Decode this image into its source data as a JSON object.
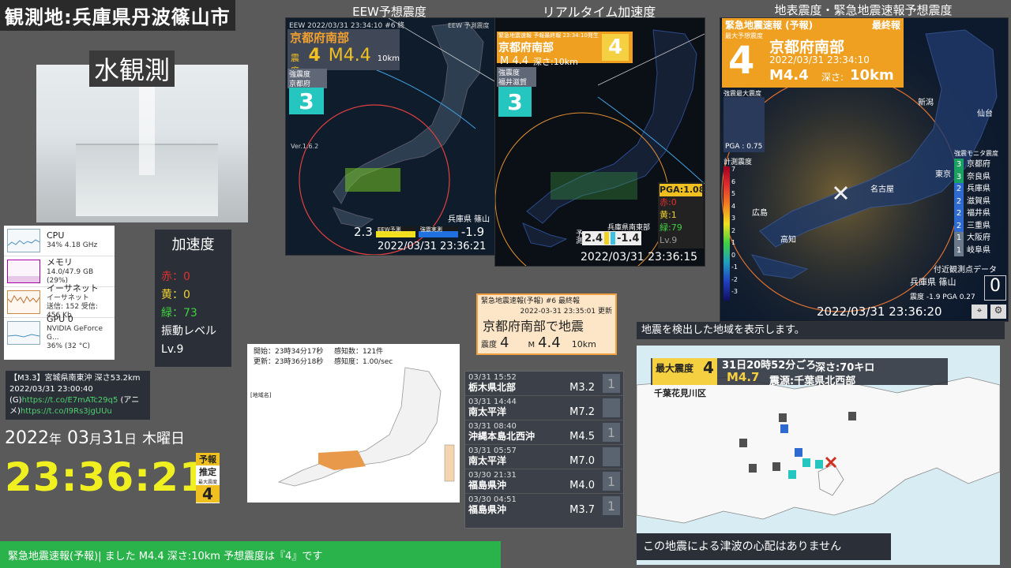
{
  "location_title": "観測地:兵庫県丹波篠山市",
  "water": {
    "label": "水観測"
  },
  "monitor": {
    "items": [
      {
        "name": "CPU",
        "detail": "34% 4.18 GHz"
      },
      {
        "name": "メモリ",
        "detail": "14.0/47.9 GB (29%)"
      },
      {
        "name": "イーサネット",
        "detail": "イーサネット\n送信: 152 受信: 456 Kb"
      },
      {
        "name": "GPU 0",
        "detail": "NVIDIA GeForce G...\n36% (32 °C)"
      }
    ]
  },
  "accel": {
    "title": "加速度",
    "red": "赤：0",
    "yellow": "黄：0",
    "green": "緑：73",
    "vib_label": "振動レベル",
    "vib_level": "Lv.9"
  },
  "tweet": {
    "line1": "【M3.3】宮城県南東沖 深さ53.2km",
    "line2": "2022/03/31 23:00:40",
    "line3a": "(G)",
    "line3b": "https://t.co/E7mATc29q5",
    "line3c": " (アニ",
    "line4a": "メ)",
    "line4b": "https://t.co/I9Rs3jgUUu"
  },
  "clock": {
    "date_y": "2022",
    "date_y_unit": "年",
    "date_m": "03",
    "date_m_unit": "月",
    "date_d": "31",
    "date_d_unit": "日",
    "weekday": "木曜日",
    "time": "23:36:21",
    "badge_top": "予報",
    "badge_mid": "推定",
    "badge_sub": "最大震度",
    "badge_int": "4"
  },
  "eew_panel": {
    "caption": "EEW予想震度",
    "header": "EEW  2022/03/31  23:34:10  #6  終",
    "region": "京都府南部",
    "int_label": "震度",
    "int": "4",
    "mag": "M4.4",
    "depth": "10km",
    "strong_label": "強震度",
    "strong_pref": "京都府",
    "strong_int": "3",
    "version": "Ver.1.6.2",
    "station": "兵庫県 篠山",
    "left_val": "2.3",
    "legend1": "EEW予測",
    "legend2": "強震実測",
    "right_val": "-1.9",
    "timestamp": "2022/03/31  23:36:21",
    "corner_label": "EEW 予測震度"
  },
  "realtime_panel": {
    "caption": "リアルタイム加速度",
    "header": "緊急地震速報 予報最終報 23:34:10発生",
    "region": "京都府南部",
    "mag": "M 4.4",
    "depth": "深さ:10km",
    "int": "4",
    "strong_label": "強震度",
    "strong_pref": "福井滋賀",
    "strong_int": "3",
    "pga": "PGA:1.08",
    "red": "赤:0",
    "yellow": "黄:1",
    "green": "緑:79",
    "lv": "Lv.9",
    "station": "兵庫県南東部",
    "left_val": "2.4",
    "right_val": "-1.4",
    "timestamp": "2022/03/31  23:36:15",
    "side_label": "予測"
  },
  "surface_panel": {
    "caption": "地表震度・緊急地震速報予想震度",
    "header_left": "緊急地震速報 (予報)",
    "header_right": "最終報",
    "maxlabel": "最大予想震度",
    "int": "4",
    "region": "京都府南部",
    "datetime": "2022/03/31  23:34:10",
    "mag": "M4.4",
    "depth_label": "深さ:",
    "depth": "10km",
    "strong_max": "強震最大震度",
    "pga": "PGA : 0.75",
    "scale_title": "計測震度",
    "scale_ticks": [
      "7",
      "6",
      "5",
      "4",
      "3",
      "2",
      "1",
      "0",
      "-1",
      "-2",
      "-3"
    ],
    "monitor_title": "強震モニタ震度",
    "prefs": [
      {
        "int": "3",
        "name": "京都府"
      },
      {
        "int": "3",
        "name": "奈良県"
      },
      {
        "int": "2",
        "name": "兵庫県"
      },
      {
        "int": "2",
        "name": "滋賀県"
      },
      {
        "int": "2",
        "name": "福井県"
      },
      {
        "int": "2",
        "name": "三重県"
      },
      {
        "int": "1",
        "name": "大阪府"
      },
      {
        "int": "1",
        "name": "岐阜県"
      }
    ],
    "nearby": "付近観測点データ",
    "station": "兵庫県 篠山",
    "station_int": "0",
    "station_vals": "震度 -1.9   PGA  0.27",
    "timestamp": "2022/03/31  23:36:20",
    "cities": [
      "新潟",
      "仙台",
      "名古屋",
      "広島",
      "高知",
      "東京"
    ]
  },
  "eew_notice": {
    "title": "緊急地震速報(予報)  #6 最終報",
    "updated": "2022-03-31 23:35:01 更新",
    "headline": "京都府南部で地震",
    "int_label": "震度",
    "int": "4",
    "mag_label": "M",
    "mag": "4.4",
    "depth": "10km"
  },
  "detect_map": {
    "start": "開始：23時34分17秒",
    "count": "感知数：121件",
    "updated": "更新：23時36分18秒",
    "freq": "感知度：1.00/sec",
    "legend_title": "[地域名]"
  },
  "quake_list": [
    {
      "date": "03/31  15:52",
      "place": "栃木県北部",
      "mag": "M3.2",
      "int": "1"
    },
    {
      "date": "03/31  14:44",
      "place": "南太平洋",
      "mag": "M7.2",
      "int": ""
    },
    {
      "date": "03/31  08:40",
      "place": "沖縄本島北西沖",
      "mag": "M4.5",
      "int": "1"
    },
    {
      "date": "03/31  05:57",
      "place": "南太平洋",
      "mag": "M7.0",
      "int": ""
    },
    {
      "date": "03/30  21:31",
      "place": "福島県沖",
      "mag": "M4.0",
      "int": "1"
    },
    {
      "date": "03/30  04:51",
      "place": "福島県沖",
      "mag": "M3.7",
      "int": "1"
    }
  ],
  "region_map": {
    "banner": "地震を検出した地域を表示します。",
    "max_label": "最大震度",
    "max_int": "4",
    "time": "31日20時52分ごろ",
    "mag": "M4.7",
    "depth": "深さ:70キロ",
    "epicenter": "震源:千葉県北西部",
    "area": "千葉花見川区",
    "tsunami": "この地震による津波の心配はありません"
  },
  "ticker": {
    "text": "緊急地震速報(予報)|    ました   M4.4   深さ:10km   予想震度は『4』です"
  }
}
